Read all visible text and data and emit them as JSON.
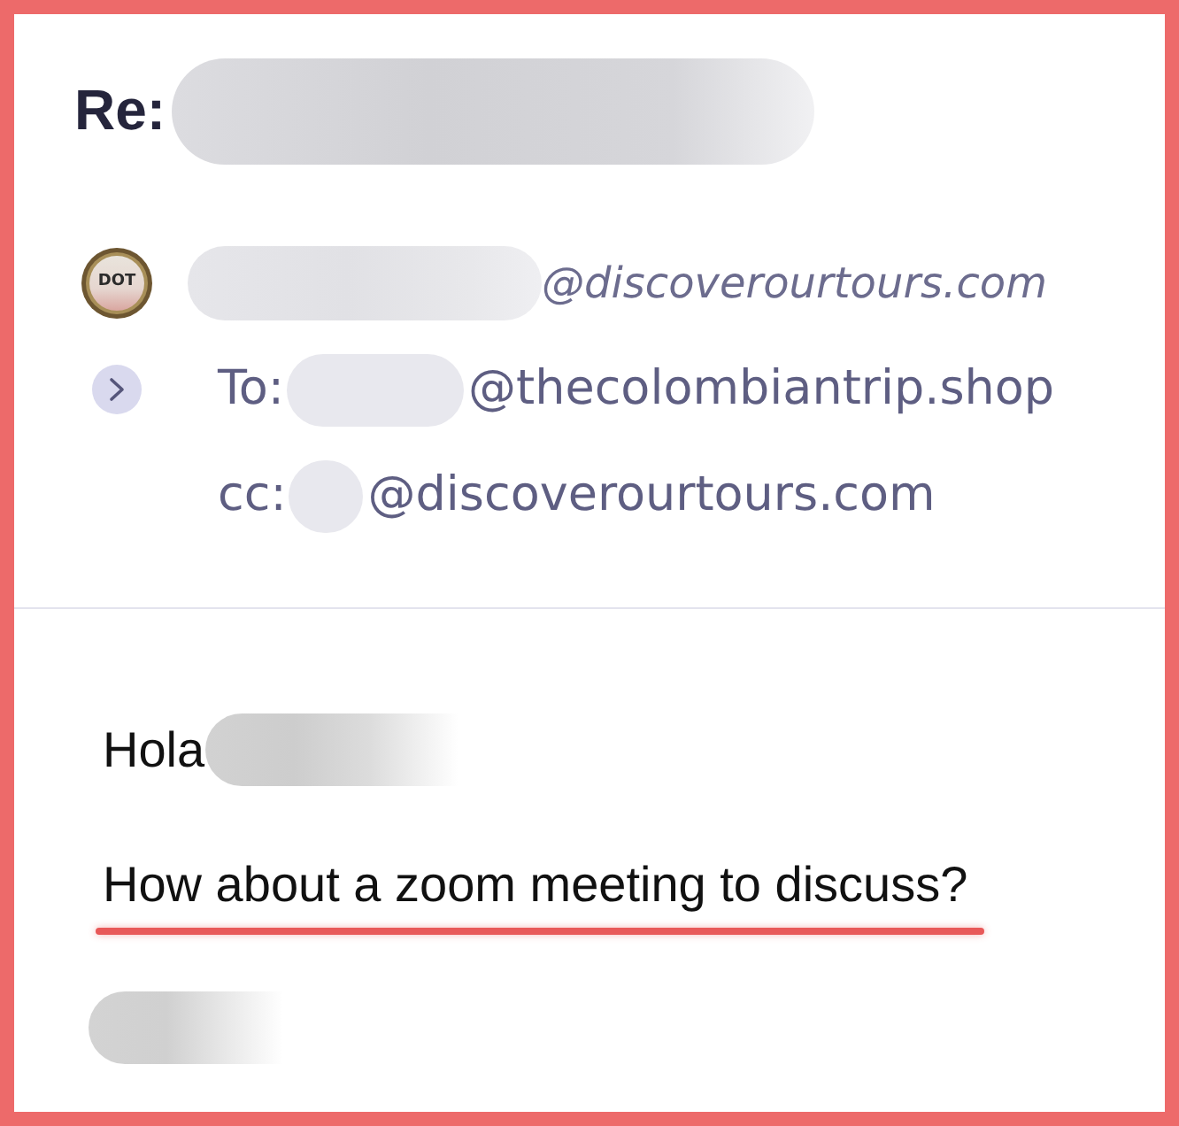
{
  "subject": {
    "prefix": "Re:",
    "redacted": true
  },
  "sender": {
    "avatar_text": "DOT",
    "name_redacted": true,
    "address": "@discoverourtours.com"
  },
  "details_expanded": false,
  "recipients": [
    {
      "label": "To:",
      "redacted": true,
      "address": "@thecolombiantrip.shop"
    },
    {
      "label": "cc:",
      "redacted": true,
      "address": "@discoverourtours.com"
    }
  ],
  "body": {
    "greeting": {
      "text": "Hola",
      "redacted": true
    },
    "message": {
      "text": "How about a zoom meeting to discuss?",
      "underlined": true
    },
    "signature_redacted": true
  }
}
